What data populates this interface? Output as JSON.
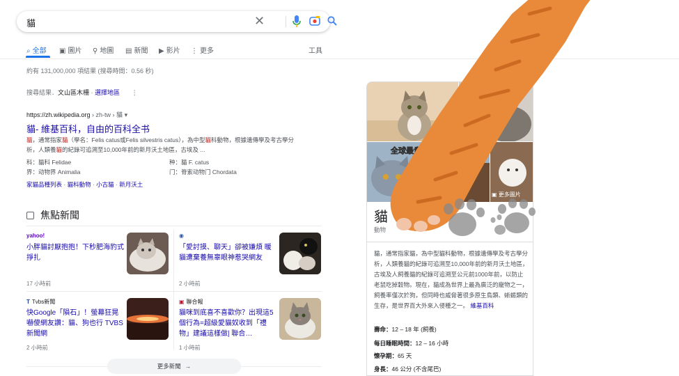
{
  "search": {
    "query": "貓"
  },
  "tabs": [
    {
      "label": "全部",
      "icon": "search-icon"
    },
    {
      "label": "圖片",
      "icon": "image-icon"
    },
    {
      "label": "地圖",
      "icon": "pin-icon"
    },
    {
      "label": "新聞",
      "icon": "news-icon"
    },
    {
      "label": "影片",
      "icon": "play-icon"
    },
    {
      "label": "更多",
      "icon": "more-icon"
    }
  ],
  "tools_label": "工具",
  "stats": "約有 131,000,000 項結果 (搜尋時間：0.56 秒)",
  "location": {
    "prefix": "搜尋結果．",
    "place": "文山區木柵",
    "change_link": "選擇地區"
  },
  "result": {
    "url": "https://zh.wikipedia.org",
    "url_path": " › zh-tw › 貓",
    "title": "貓- 維基百科，自由的百科全书",
    "snippet_hl": "貓",
    "snippet_a": "，通常指家",
    "snippet_hl2": "貓",
    "snippet_b": "（學名：Felis catus或Felis silvestris catus），為中型",
    "snippet_hl3": "貓",
    "snippet_c": "科動物，根據遺傳學及考古學分析，人類養",
    "snippet_hl4": "貓",
    "snippet_d": "的紀錄可追溯至10,000年前的新月沃土地區，古埃及 ...",
    "attrs": [
      {
        "k": "科：",
        "v": "貓科 Felidae"
      },
      {
        "k": "种：",
        "v": "貓 F. catus"
      },
      {
        "k": "界：",
        "v": "动物界 Animalia"
      },
      {
        "k": "门：",
        "v": "脊索动物门 Chordata"
      }
    ],
    "sitelinks": [
      "家貓品種列表",
      "貓科動物",
      "小古貓",
      "新月沃土"
    ]
  },
  "news": {
    "heading": "焦點新聞",
    "cards": [
      {
        "source": "yahoo!",
        "headline": "小胖貓討厭抱抱！下秒肥海豹式掙扎",
        "time": "17 小時前"
      },
      {
        "source": "",
        "headline": "「愛討摸、聊天」卻被嫌煩 暖貓遭棄養無辜眼神惹哭網友",
        "time": "2 小時前"
      },
      {
        "source": "Tvbs新聞",
        "headline": "快Google「隕石」！螢幕狂晃嚇傻網友讚：貓、狗也行 TVBS新聞網",
        "time": "2 小時前"
      },
      {
        "source": "聯合報",
        "headline": "貓咪到底喜不喜歡你？出現這5個行為=超級愛貓奴收到「禮物」建議這樣做| 聯合…",
        "time": "1 小時前"
      }
    ],
    "more_label": "更多新聞"
  },
  "knowledge": {
    "title": "貓",
    "subtitle": "動物",
    "banner": "全球最貴的",
    "more_images": "更多圖片",
    "description": "貓，通常指家貓，為中型貓科動物，根據遺傳學及考古學分析，人類養貓的紀錄可追溯至10,000年前的新月沃土地區，古埃及人飼養貓的紀錄可追溯至公元前1000年前，以防止老鼠吃掉穀物。現在，貓成為世界上最為廣泛的寵物之一，飼養率僅次於狗，但同時也威脅著很多原生鳥類、蜥蜴類的生存，是世界百大外來入侵種之一。",
    "source_link": "維基百科",
    "facts": [
      {
        "k": "壽命：",
        "v": "12 – 18 年 (飼養)"
      },
      {
        "k": "每日睡眠時間：",
        "v": "12 – 16 小時"
      },
      {
        "k": "懷孕期：",
        "v": "65 天"
      },
      {
        "k": "身長：",
        "v": "46 公分 (不含尾巴)"
      }
    ]
  },
  "colors": {
    "link": "#1a0dab",
    "accent": "#1a73e8",
    "paw_orange": "#e88a3a",
    "paw_grey": "#888888"
  }
}
